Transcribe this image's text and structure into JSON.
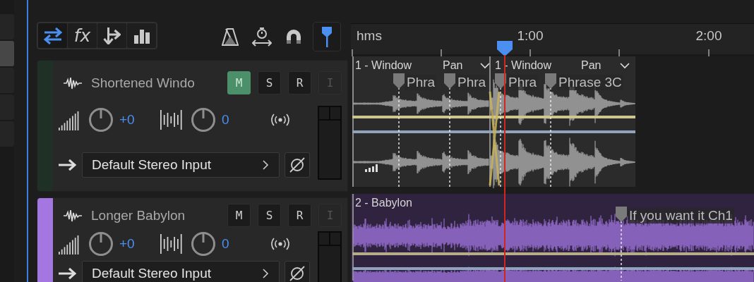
{
  "toolbar": {
    "view_buttons": [
      {
        "kind": "inputs",
        "selected": true
      },
      {
        "kind": "effects",
        "label": "fx",
        "selected": false
      },
      {
        "kind": "sends",
        "selected": false
      },
      {
        "kind": "eq",
        "selected": false
      }
    ],
    "tools": [
      {
        "kind": "metronome",
        "on": false
      },
      {
        "kind": "stretch",
        "on": false
      },
      {
        "kind": "snap",
        "on": false
      },
      {
        "kind": "follow",
        "on": true
      }
    ]
  },
  "ruler": {
    "unit": "hms",
    "time_labels": [
      "1:00",
      "2:00"
    ]
  },
  "tracks": [
    {
      "name": "Shortened Windo",
      "color": "#1f3026",
      "buttons": [
        {
          "label": "M",
          "on": true,
          "disabled": false
        },
        {
          "label": "S",
          "on": false,
          "disabled": false
        },
        {
          "label": "R",
          "on": false,
          "disabled": false
        },
        {
          "label": "I",
          "on": false,
          "disabled": true
        }
      ],
      "volume": "+0",
      "pan": "0",
      "input": "Default Stereo Input",
      "clips": [
        {
          "title": "1 - Window",
          "label": "Pan"
        },
        {
          "title": "1 - Window",
          "label": "Pan"
        }
      ],
      "markers": [
        "Phra",
        "Phra",
        "Phra",
        "Phrase 3C"
      ]
    },
    {
      "name": "Longer Babylon",
      "color": "#a376e2",
      "buttons": [
        {
          "label": "M",
          "on": false,
          "disabled": false
        },
        {
          "label": "S",
          "on": false,
          "disabled": false
        },
        {
          "label": "R",
          "on": false,
          "disabled": false
        },
        {
          "label": "I",
          "on": false,
          "disabled": true
        }
      ],
      "volume": "+0",
      "pan": "0",
      "input": "Default Stereo Input",
      "clips": [
        {
          "title": "2 - Babylon"
        }
      ],
      "markers": [
        "If you want it Ch1"
      ]
    }
  ]
}
